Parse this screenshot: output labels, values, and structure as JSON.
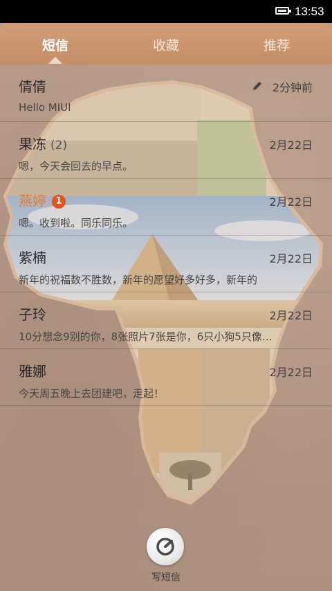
{
  "status_bar": {
    "time": "13:53"
  },
  "tabs": [
    {
      "label": "短信",
      "active": true
    },
    {
      "label": "收藏",
      "active": false
    },
    {
      "label": "推荐",
      "active": false
    }
  ],
  "threads": [
    {
      "name": "倩倩",
      "count": "",
      "badge": "",
      "preview": "Hello MIUI",
      "time": "2分钟前",
      "draft": true,
      "unread": false
    },
    {
      "name": "果冻",
      "count": "(2)",
      "badge": "",
      "preview": "嗯，今天会回去的早点。",
      "time": "2月22日",
      "draft": false,
      "unread": false
    },
    {
      "name": "燕婷",
      "count": "",
      "badge": "1",
      "preview": "嗯。收到啦。同乐同乐。",
      "time": "2月22日",
      "draft": false,
      "unread": true
    },
    {
      "name": "紫楠",
      "count": "",
      "badge": "",
      "preview": "新年的祝福数不胜数，新年的愿望好多好多，新年的",
      "time": "2月22日",
      "draft": false,
      "unread": false
    },
    {
      "name": "子玲",
      "count": "",
      "badge": "",
      "preview": "10分想念9别的你，8张照片7张是你，6只小狗5只像…",
      "time": "2月22日",
      "draft": false,
      "unread": false
    },
    {
      "name": "雅娜",
      "count": "",
      "badge": "",
      "preview": "今天周五晚上去团建吧，走起！",
      "time": "2月22日",
      "draft": false,
      "unread": false
    }
  ],
  "compose": {
    "label": "写短信"
  },
  "colors": {
    "accent": "#f07a21",
    "badge": "#e8531a",
    "header": "#c8926a"
  }
}
